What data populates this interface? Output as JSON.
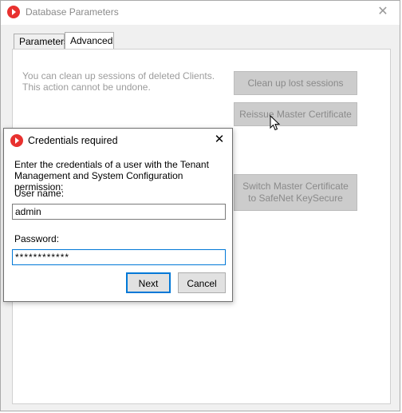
{
  "window": {
    "title": "Database Parameters",
    "close_glyph": "✕",
    "logo_icon": "app-logo-icon"
  },
  "tabs": [
    {
      "label": "Parameters",
      "selected": false
    },
    {
      "label": "Advanced",
      "selected": true
    }
  ],
  "advanced": {
    "note": "You can clean up sessions of deleted Clients. This action cannot be undone.",
    "cleanup_label": "Clean up lost sessions",
    "reissue_label": "Reissue Master Certificate",
    "switch_label": "Switch Master Certificate to SafeNet KeySecure"
  },
  "dialog": {
    "title": "Credentials required",
    "close_glyph": "✕",
    "prompt": "Enter the credentials of a user with the Tenant Management and System Configuration permission:",
    "username_label": "User name:",
    "username_value": "admin",
    "password_label": "Password:",
    "password_value": "************",
    "next_label": "Next",
    "cancel_label": "Cancel"
  },
  "colors": {
    "brand": "#e8312f",
    "focus": "#0078d7",
    "disabled_button": "#cccccc",
    "disabled_text": "#8a8a8a"
  }
}
